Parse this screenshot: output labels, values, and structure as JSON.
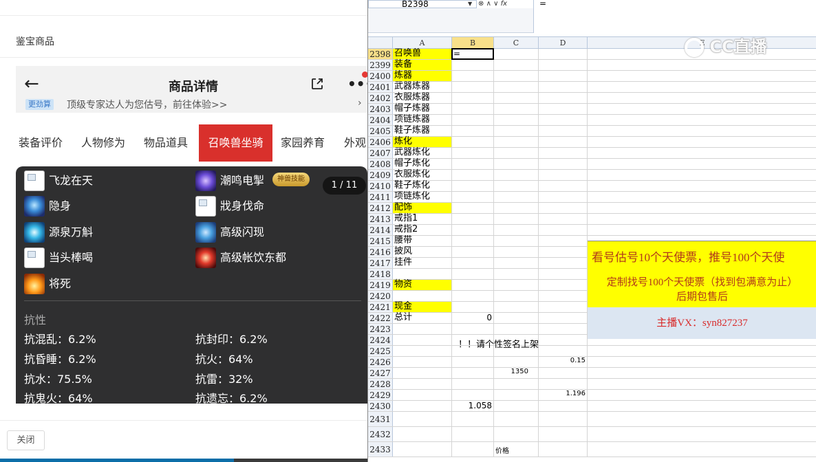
{
  "dialog": {
    "title": "鉴宝商品",
    "close_label": "关闭"
  },
  "phone": {
    "header_title": "商品详情",
    "back_icon": "←",
    "more_icon": "•••",
    "notice_badge": "更劲算",
    "notice_text": "顶级专家达人为您估号，前往体验>>",
    "notice_arrow": "›",
    "tabs": [
      "装备评价",
      "人物修为",
      "物品道具",
      "召唤兽坐骑",
      "家园养育",
      "外观"
    ],
    "active_tab": "召唤兽坐骑",
    "page_indicator": "1 / 11",
    "divine_badge": "神兽技能",
    "skills_left": [
      "飞龙在天",
      "隐身",
      "源泉万斛",
      "当头棒喝",
      "将死"
    ],
    "skills_right": [
      "潮鸣电掣",
      "戕身伐命",
      "高级闪现",
      "高级帐饮东都"
    ],
    "resist_title": "抗性",
    "resists_left": [
      "抗混乱：6.2%",
      "抗昏睡：6.2%",
      "抗水：75.5%",
      "抗鬼火：64%"
    ],
    "resists_right": [
      "抗封印：6.2%",
      "抗火：64%",
      "抗雷：32%",
      "抗遗忘：6.2%"
    ]
  },
  "excel": {
    "name_box": "B2398",
    "fx_label": "fx",
    "formula": "=",
    "columns": [
      "A",
      "B",
      "C",
      "D",
      "E"
    ],
    "rows": [
      {
        "n": "2398",
        "a": "召唤兽",
        "hl": true,
        "b": "="
      },
      {
        "n": "2399",
        "a": "装备",
        "hl": true
      },
      {
        "n": "2400",
        "a": "炼器",
        "hl": true
      },
      {
        "n": "2401",
        "a": "武器炼器"
      },
      {
        "n": "2402",
        "a": "衣服炼器"
      },
      {
        "n": "2403",
        "a": "帽子炼器"
      },
      {
        "n": "2404",
        "a": "项链炼器"
      },
      {
        "n": "2405",
        "a": "鞋子炼器"
      },
      {
        "n": "2406",
        "a": "炼化",
        "hl": true
      },
      {
        "n": "2407",
        "a": "武器炼化"
      },
      {
        "n": "2408",
        "a": "帽子炼化"
      },
      {
        "n": "2409",
        "a": "衣服炼化"
      },
      {
        "n": "2410",
        "a": "鞋子炼化"
      },
      {
        "n": "2411",
        "a": "项链炼化"
      },
      {
        "n": "2412",
        "a": "配饰",
        "hl": true
      },
      {
        "n": "2413",
        "a": "戒指1"
      },
      {
        "n": "2414",
        "a": "戒指2"
      },
      {
        "n": "2415",
        "a": "腰带"
      },
      {
        "n": "2416",
        "a": "披风"
      },
      {
        "n": "2417",
        "a": "挂件"
      },
      {
        "n": "2418",
        "a": ""
      },
      {
        "n": "2419",
        "a": "物资",
        "hl": true
      },
      {
        "n": "2420",
        "a": ""
      },
      {
        "n": "2421",
        "a": "现金",
        "hl": true
      },
      {
        "n": "2422",
        "a": "总计",
        "b": "0"
      },
      {
        "n": "2423",
        "a": ""
      },
      {
        "n": "2424",
        "a": ""
      },
      {
        "n": "2425",
        "a": ""
      },
      {
        "n": "2426",
        "a": "",
        "d": "0.15"
      },
      {
        "n": "2427",
        "a": "",
        "c": "1350"
      },
      {
        "n": "2428",
        "a": ""
      },
      {
        "n": "2429",
        "a": "",
        "d": "1.196"
      },
      {
        "n": "2430",
        "a": "",
        "b": "1.058"
      },
      {
        "n": "2431",
        "a": ""
      },
      {
        "n": "2432",
        "a": ""
      },
      {
        "n": "2433",
        "a": "",
        "c": "价格"
      }
    ],
    "signature_cell": "请个性签名上架！！！",
    "merged_text_1": "看号估号10个天使票，推号100个天使",
    "merged_text_2a": "定制找号100个天使票（找到包满意为止）",
    "merged_text_2b": "后期包售后",
    "merged_text_3": "主播VX：syn827237"
  },
  "watermark": "CC直播"
}
